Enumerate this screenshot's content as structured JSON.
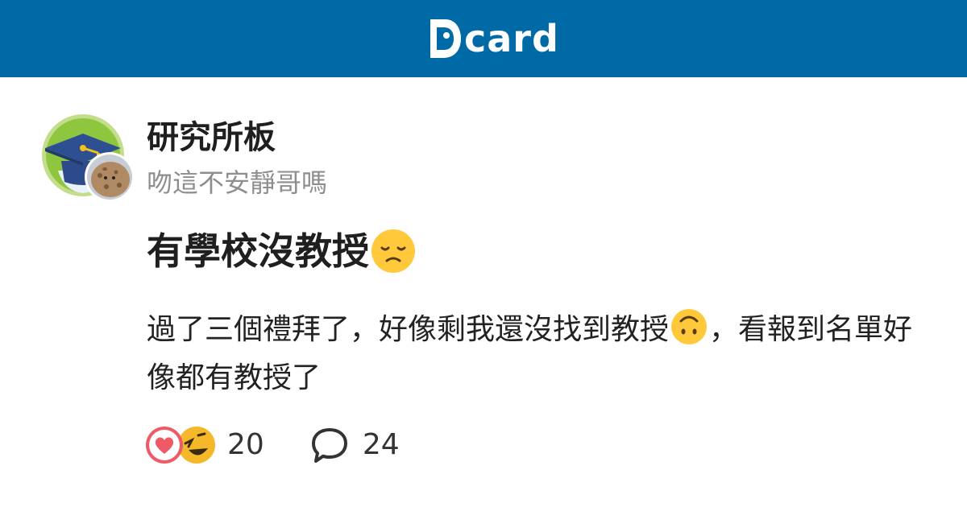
{
  "app": {
    "logo_text": "card",
    "brand_color": "#006aa6"
  },
  "forum": {
    "name": "研究所板",
    "avatar_icon": "graduation-cap-icon"
  },
  "author": {
    "name": "吻這不安靜哥嗎",
    "avatar_icon": "potato-avatar-icon"
  },
  "post": {
    "title": "有學校沒教授",
    "title_emoji": "disappointed-face-icon",
    "body_part1": "過了三個禮拜了，好像剩我還沒找到教授",
    "body_emoji": "upside-down-face-icon",
    "body_part2": "，看報到名單好像都有教授了"
  },
  "stats": {
    "reaction_icons": [
      "heart-reaction-icon",
      "laughing-reaction-icon"
    ],
    "reaction_count": "20",
    "comment_icon": "comment-bubble-icon",
    "comment_count": "24"
  }
}
